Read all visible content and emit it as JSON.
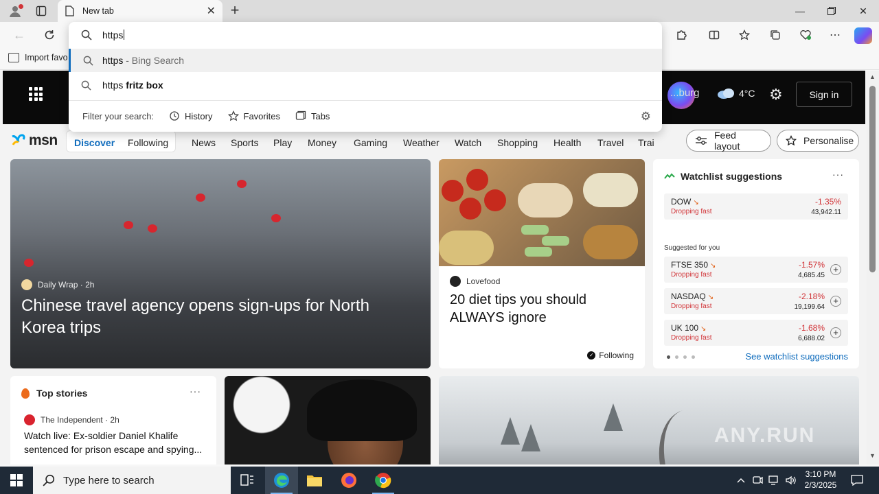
{
  "browser": {
    "tab_title": "New tab",
    "address_text": "https",
    "favorites_item": "Import favo"
  },
  "omnibox": {
    "suggestions": [
      {
        "query": "https",
        "suffix": " - Bing Search",
        "bold": ""
      },
      {
        "query": "https ",
        "suffix": "",
        "bold": "fritz box"
      }
    ],
    "filter_label": "Filter your search:",
    "filters": [
      "History",
      "Favorites",
      "Tabs"
    ]
  },
  "msn": {
    "weather_location": "...burg",
    "weather_temp": "4°C",
    "sign_in": "Sign in",
    "logo": "msn",
    "nav_active": "Discover",
    "nav_following": "Following",
    "nav_links": [
      "News",
      "Sports",
      "Play",
      "Money",
      "Gaming",
      "Weather",
      "Watch",
      "Shopping",
      "Health",
      "Travel",
      "Trai"
    ],
    "feed_layout": "Feed layout",
    "personalise": "Personalise"
  },
  "hero": {
    "source": "Daily Wrap · 2h",
    "title": "Chinese travel agency opens sign-ups for North Korea trips"
  },
  "food": {
    "source": "Lovefood",
    "title": "20 diet tips you should ALWAYS ignore",
    "following": "Following"
  },
  "watchlist": {
    "title": "Watchlist suggestions",
    "suggested_label": "Suggested for you",
    "see_link": "See watchlist suggestions",
    "items": [
      {
        "name": "DOW",
        "status": "Dropping fast",
        "pct": "-1.35%",
        "value": "43,942.11"
      },
      {
        "name": "FTSE 350",
        "status": "Dropping fast",
        "pct": "-1.57%",
        "value": "4,685.45"
      },
      {
        "name": "NASDAQ",
        "status": "Dropping fast",
        "pct": "-2.18%",
        "value": "19,199.64"
      },
      {
        "name": "UK 100",
        "status": "Dropping fast",
        "pct": "-1.68%",
        "value": "6,688.02"
      }
    ]
  },
  "top_stories": {
    "title": "Top stories",
    "source": "The Independent · 2h",
    "headline": "Watch live: Ex-soldier Daniel Khalife sentenced for prison escape and spying..."
  },
  "taskbar": {
    "search_placeholder": "Type here to search",
    "time": "3:10 PM",
    "date": "2/3/2025"
  },
  "watermark": "ANY.RUN"
}
